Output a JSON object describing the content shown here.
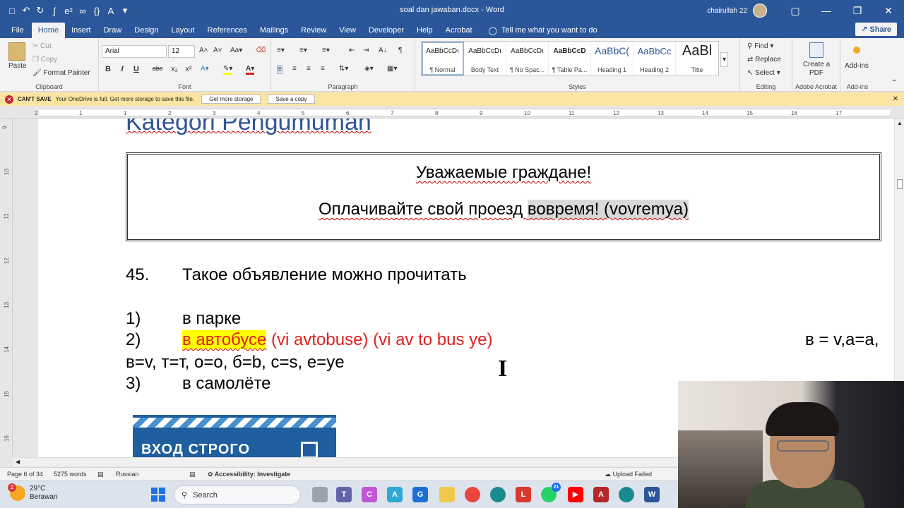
{
  "window": {
    "doc_title": "soal dan jawaban.docx  -  Word",
    "user_name": "chairullah 22",
    "minimize": "—",
    "restore": "❐",
    "close": "✕"
  },
  "qat": {
    "icons": [
      "save-icon",
      "undo-icon",
      "redo-icon"
    ]
  },
  "tabs": {
    "file": "File",
    "home": "Home",
    "insert": "Insert",
    "draw": "Draw",
    "design": "Design",
    "layout": "Layout",
    "references": "References",
    "mailings": "Mailings",
    "review": "Review",
    "view": "View",
    "developer": "Developer",
    "help": "Help",
    "acrobat": "Acrobat",
    "tell_me": "Tell me what you want to do",
    "share": "Share"
  },
  "ribbon": {
    "clipboard": {
      "paste": "Paste",
      "cut": "Cut",
      "copy": "Copy",
      "format_painter": "Format Painter",
      "label": "Clipboard"
    },
    "font": {
      "name": "Arial",
      "size": "12",
      "label": "Font",
      "bold": "B",
      "italic": "I",
      "underline": "U",
      "strike": "abc",
      "sub": "x₂",
      "sup": "x²"
    },
    "paragraph": {
      "label": "Paragraph"
    },
    "styles": {
      "label": "Styles",
      "items": [
        {
          "preview": "AaBbCcDı",
          "name": "¶ Normal"
        },
        {
          "preview": "AaBbCcDı",
          "name": "Body Text"
        },
        {
          "preview": "AaBbCcDı",
          "name": "¶ No Spac..."
        },
        {
          "preview": "AaBbCcD",
          "name": "¶ Table Pa..."
        },
        {
          "preview": "AaBbC(",
          "name": "Heading 1"
        },
        {
          "preview": "AaBbCc",
          "name": "Heading 2"
        },
        {
          "preview": "AaBl",
          "name": "Title"
        }
      ]
    },
    "editing": {
      "find": "Find",
      "replace": "Replace",
      "select": "Select",
      "label": "Editing"
    },
    "acrobat": {
      "create_pdf": "Create a PDF",
      "label": "Adobe Acrobat"
    },
    "addins": {
      "button": "Add-ins",
      "label": "Add-ins"
    }
  },
  "message_bar": {
    "title": "CAN'T SAVE",
    "text": "Your OneDrive is full. Get more storage to save this file.",
    "btn_storage": "Get more storage",
    "btn_copy": "Save a copy",
    "close": "✕"
  },
  "ruler": {
    "h_ticks": [
      "2",
      "1",
      "1",
      "2",
      "3",
      "4",
      "5",
      "6",
      "7",
      "8",
      "9",
      "10",
      "11",
      "12",
      "13",
      "14",
      "15",
      "16",
      "17"
    ],
    "v_ticks": [
      "9",
      "10",
      "11",
      "12",
      "13",
      "14",
      "15",
      "16"
    ]
  },
  "document": {
    "heading": "Kategori Pengumuman",
    "box_line1": "Уважаемые граждане!",
    "box_line2_a": "Оплачивайте свой проезд ",
    "box_line2_b": "вовремя! (vovremya)",
    "q_num": "45.",
    "q_text": "Такое объявление можно прочитать",
    "opt1_num": "1)",
    "opt1_text": "в парке",
    "opt2_num": "2)",
    "opt2_highlight": "в автобусе",
    "opt2_note": " (vi avtobuse) (vi av to bus ye)",
    "note_right": "в = v,а=a,",
    "note_line2": "в=v, т=т, о=o, б=b, c=s, e=ye",
    "opt3_num": "3)",
    "opt3_text": "в самолёте",
    "image_text": "ВХОД СТРОГО"
  },
  "status": {
    "page": "Page 6 of 34",
    "words": "5275 words",
    "language": "Russian",
    "accessibility": "Accessibility: Investigate",
    "upload": "Upload Failed"
  },
  "taskbar": {
    "temp": "29°C",
    "weather": "Berawan",
    "weather_badge": "2",
    "search": "Search",
    "whatsapp_badge": "21"
  }
}
